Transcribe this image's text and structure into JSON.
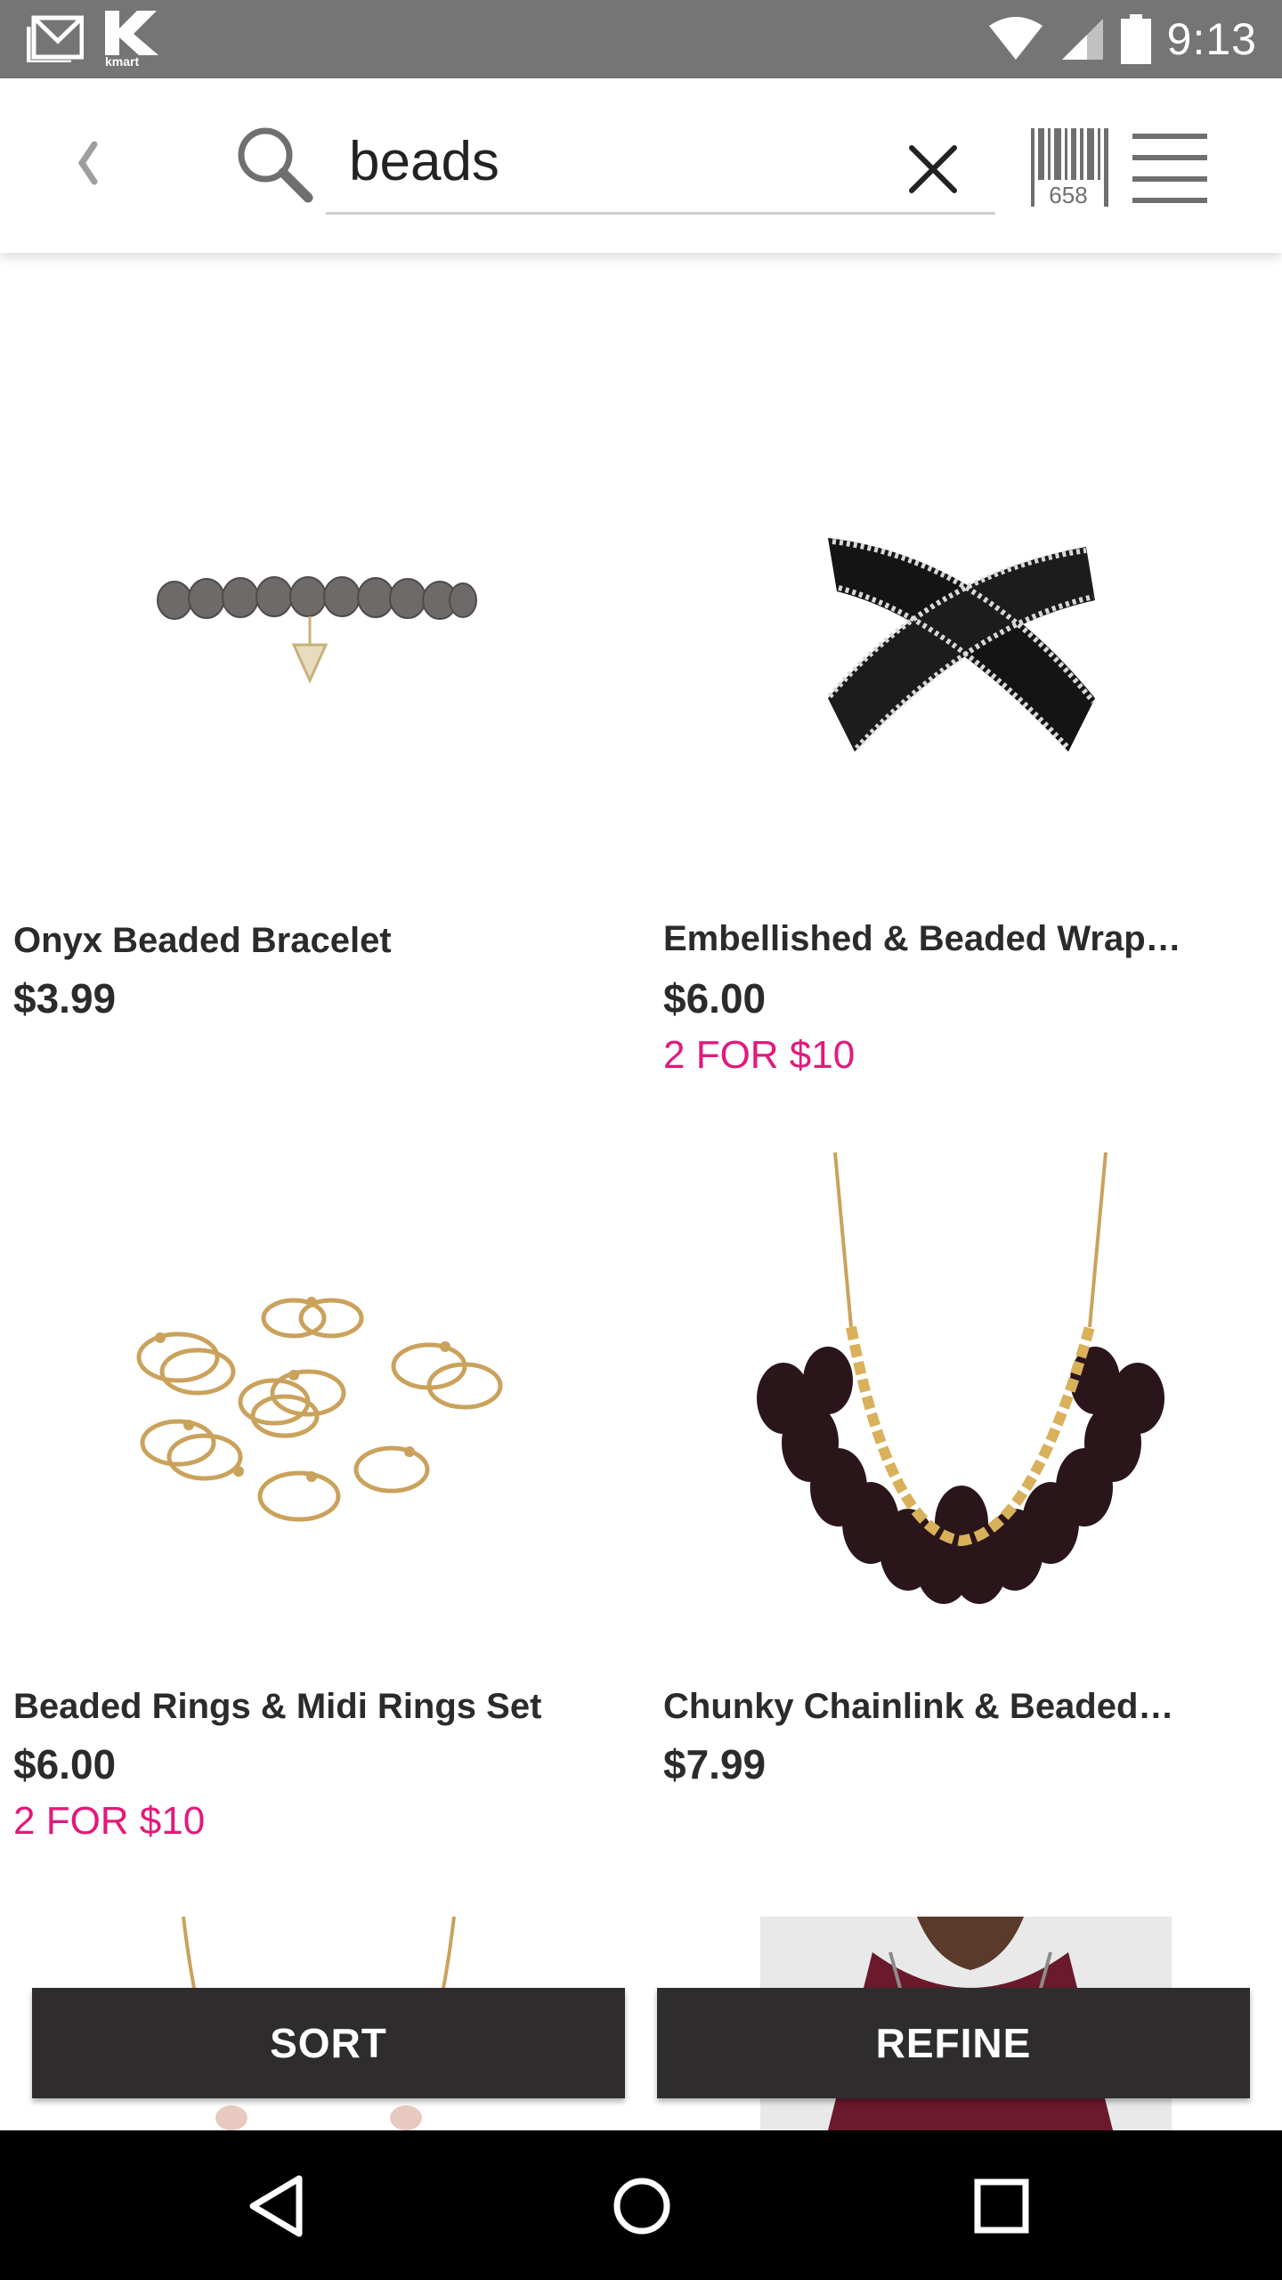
{
  "status_bar": {
    "time": "9:13",
    "icons": [
      "gmail-icon",
      "kmart-app-icon",
      "wifi-icon",
      "signal-icon",
      "battery-icon"
    ],
    "kmart_label": "kmart"
  },
  "toolbar": {
    "back_icon": "chevron-left-icon",
    "search_icon": "search-icon",
    "search_value": "beads",
    "clear_icon": "close-icon",
    "barcode_number": "658",
    "menu_icon": "menu-icon"
  },
  "products": [
    {
      "name": "Onyx Beaded Bracelet",
      "price": "$3.99",
      "promo": ""
    },
    {
      "name": "Embellished & Beaded Wrap…",
      "price": "$6.00",
      "promo": "2 FOR $10"
    },
    {
      "name": "Beaded Rings & Midi Rings Set",
      "price": "$6.00",
      "promo": "2 FOR $10"
    },
    {
      "name": "Chunky Chainlink & Beaded…",
      "price": "$7.99",
      "promo": ""
    }
  ],
  "actions": {
    "sort_label": "SORT",
    "refine_label": "REFINE"
  },
  "colors": {
    "status_bar": "#757575",
    "promo": "#e2197a",
    "action_button": "#2f2c2d"
  }
}
